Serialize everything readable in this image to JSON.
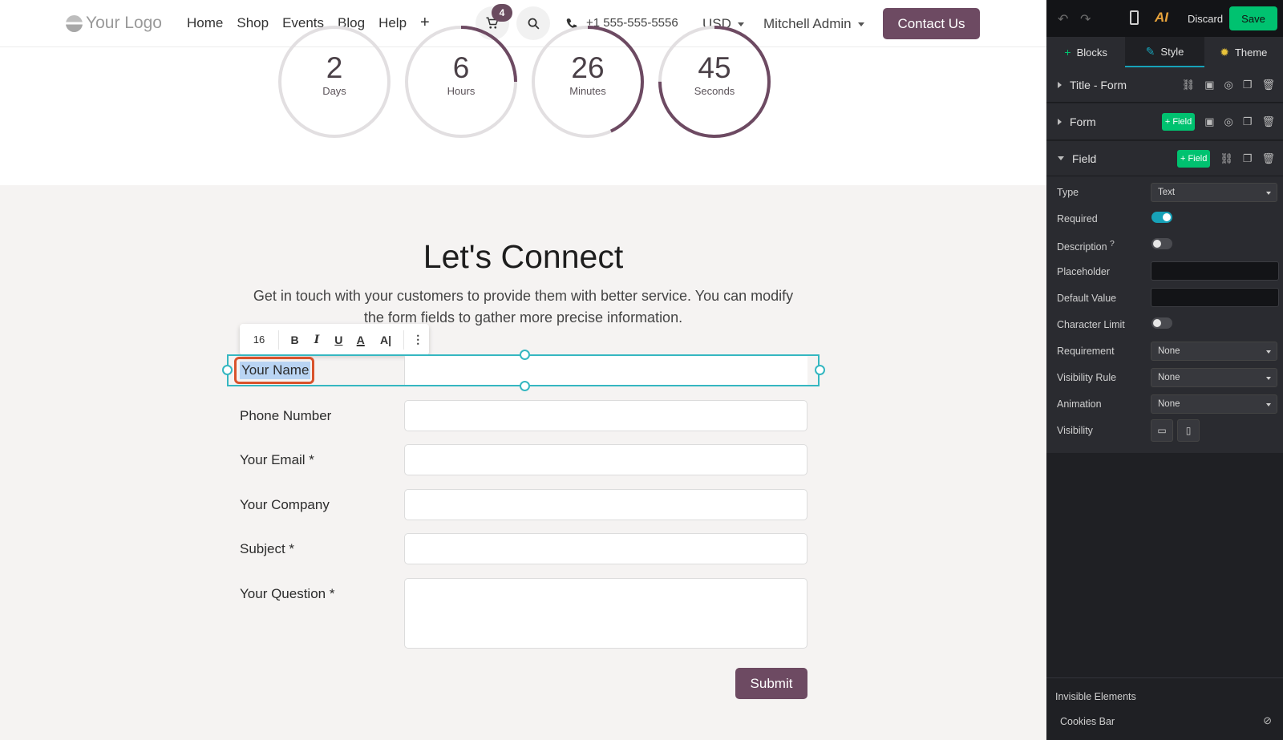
{
  "navbar": {
    "logo": "Your Logo",
    "links": [
      "Home",
      "Shop",
      "Events",
      "Blog",
      "Help"
    ],
    "plus": "+",
    "cart_count": "4",
    "phone": "+1 555-555-5556",
    "currency": "USD",
    "user": "Mitchell Admin",
    "contact": "Contact Us"
  },
  "countdown": [
    {
      "value": "2",
      "label": "Days",
      "fraction": 0.0
    },
    {
      "value": "6",
      "label": "Hours",
      "fraction": 0.25
    },
    {
      "value": "26",
      "label": "Minutes",
      "fraction": 0.43
    },
    {
      "value": "45",
      "label": "Seconds",
      "fraction": 0.75
    }
  ],
  "main": {
    "title": "Let's Connect",
    "subtitle": "Get in touch with your customers to provide them with better service. You can modify the form fields to gather more precise information."
  },
  "text_toolbar": {
    "font_size": "16",
    "bold": "B",
    "italic": "I",
    "underline": "U",
    "color": "A",
    "ai": "A|",
    "more": "⋮"
  },
  "form": {
    "selected_label": "Your Name",
    "fields": [
      {
        "label": "Phone Number"
      },
      {
        "label": "Your Email *"
      },
      {
        "label": "Your Company"
      },
      {
        "label": "Subject *"
      },
      {
        "label": "Your Question *"
      }
    ],
    "submit": "Submit"
  },
  "editor": {
    "discard": "Discard",
    "save": "Save",
    "tabs": [
      "Blocks",
      "Style",
      "Theme"
    ],
    "sections": {
      "title_form": "Title - Form",
      "form": "Form",
      "field": "Field",
      "add_field": "+ Field"
    },
    "options": {
      "type_label": "Type",
      "type_value": "Text",
      "required_label": "Required",
      "required_on": true,
      "description_label": "Description",
      "description_help": "?",
      "placeholder_label": "Placeholder",
      "default_label": "Default Value",
      "charlimit_label": "Character Limit",
      "requirement_label": "Requirement",
      "requirement_value": "None",
      "visrule_label": "Visibility Rule",
      "visrule_value": "None",
      "animation_label": "Animation",
      "animation_value": "None",
      "visibility_label": "Visibility"
    },
    "invisible": {
      "title": "Invisible Elements",
      "item": "Cookies Bar"
    }
  },
  "colors": {
    "brand": "#6d4a62",
    "selection": "#35b7c1",
    "save": "#00c270",
    "toggle_on": "#17a2b8"
  }
}
